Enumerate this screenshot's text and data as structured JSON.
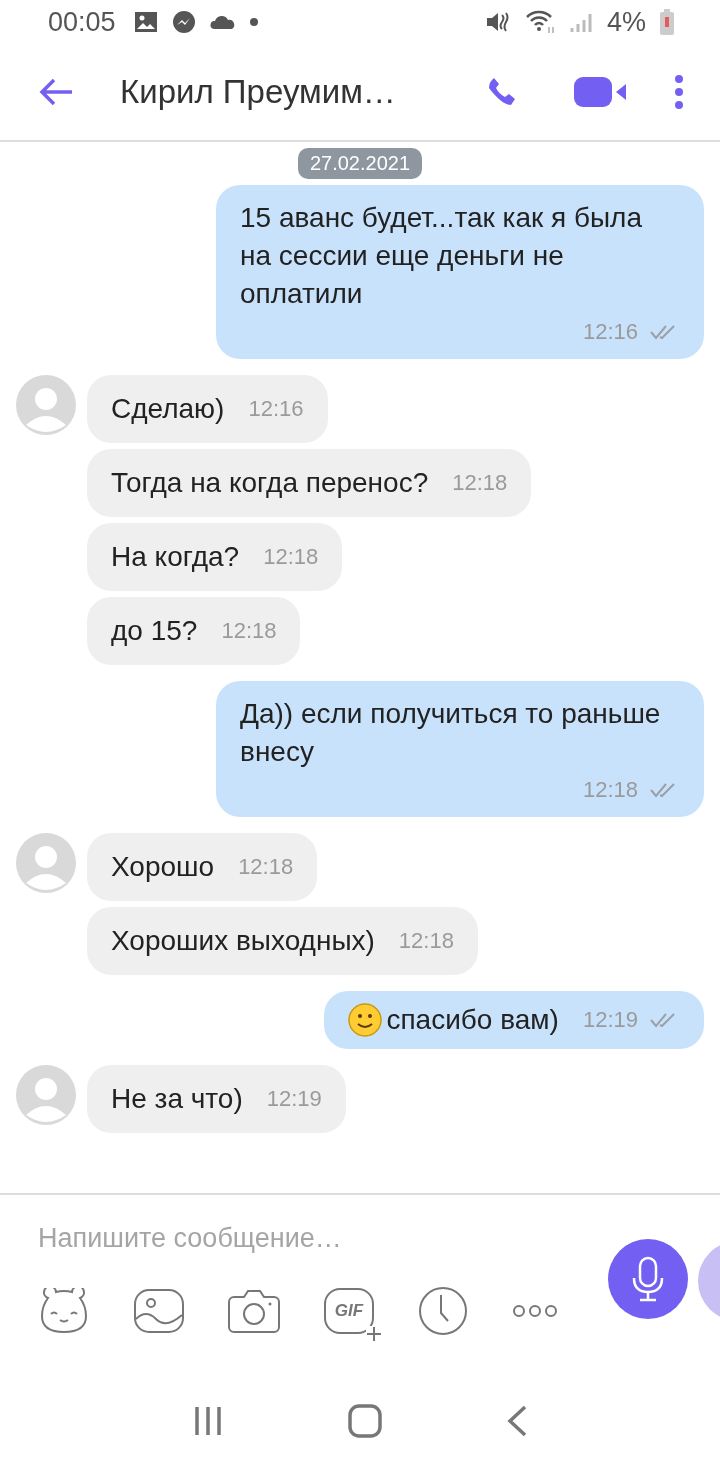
{
  "status_bar": {
    "time": "00:05",
    "battery": "4%"
  },
  "header": {
    "title": "Кирил Преумим…"
  },
  "date_badge": "27.02.2021",
  "messages": [
    {
      "kind": "outgoing",
      "text": "15 аванс будет...так как я была на сессии еще деньги не оплатили",
      "time": "12:16",
      "delivered": true,
      "smiley": false
    },
    {
      "kind": "incoming",
      "text": "Сделаю)",
      "time": "12:16",
      "avatar": true
    },
    {
      "kind": "incoming",
      "text": "Тогда на когда перенос?",
      "time": "12:18",
      "avatar": false
    },
    {
      "kind": "incoming",
      "text": "На когда?",
      "time": "12:18",
      "avatar": false
    },
    {
      "kind": "incoming",
      "text": "до 15?",
      "time": "12:18",
      "avatar": false
    },
    {
      "kind": "outgoing",
      "text": "Да)) если получиться то раньше внесу",
      "time": "12:18",
      "delivered": true,
      "smiley": false
    },
    {
      "kind": "incoming",
      "text": "Хорошо",
      "time": "12:18",
      "avatar": true
    },
    {
      "kind": "incoming",
      "text": "Хороших выходных)",
      "time": "12:18",
      "avatar": false
    },
    {
      "kind": "outgoing",
      "text": "спасибо вам)",
      "time": "12:19",
      "delivered": true,
      "smiley": true
    },
    {
      "kind": "incoming",
      "text": "Не за что)",
      "time": "12:19",
      "avatar": true
    }
  ],
  "composer": {
    "placeholder": "Напишите сообщение…",
    "gif_label": "GIF"
  }
}
